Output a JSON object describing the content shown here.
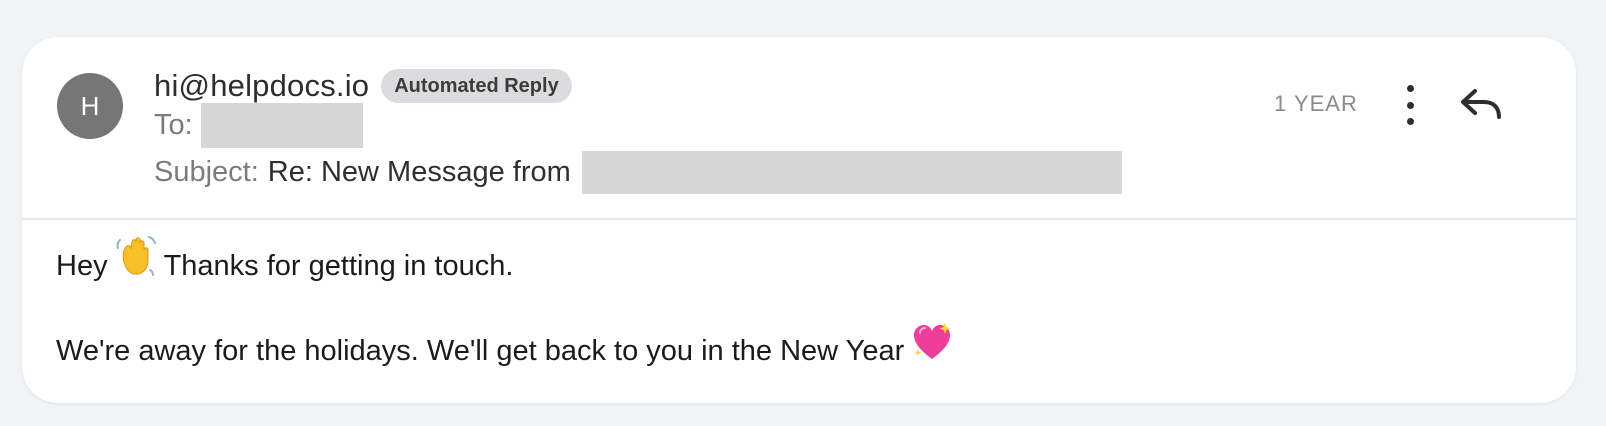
{
  "email": {
    "avatar_initial": "H",
    "sender": "hi@helpdocs.io",
    "badge": "Automated Reply",
    "to_label": "To:",
    "subject_label": "Subject:",
    "subject_text": "Re: New Message from",
    "time": "1 YEAR",
    "body": {
      "greeting": "Hey",
      "line1_rest": "Thanks for getting in touch.",
      "line2": "We're away for the holidays. We'll get back to you in the New Year"
    }
  },
  "colors": {
    "avatar_bg": "#767676",
    "badge_bg": "#dcdcde",
    "redaction": "#d6d6d6"
  },
  "icons": {
    "more": "more-vertical-icon",
    "reply": "reply-icon",
    "wave": "waving-hand-emoji",
    "heart": "sparkling-heart-emoji"
  }
}
